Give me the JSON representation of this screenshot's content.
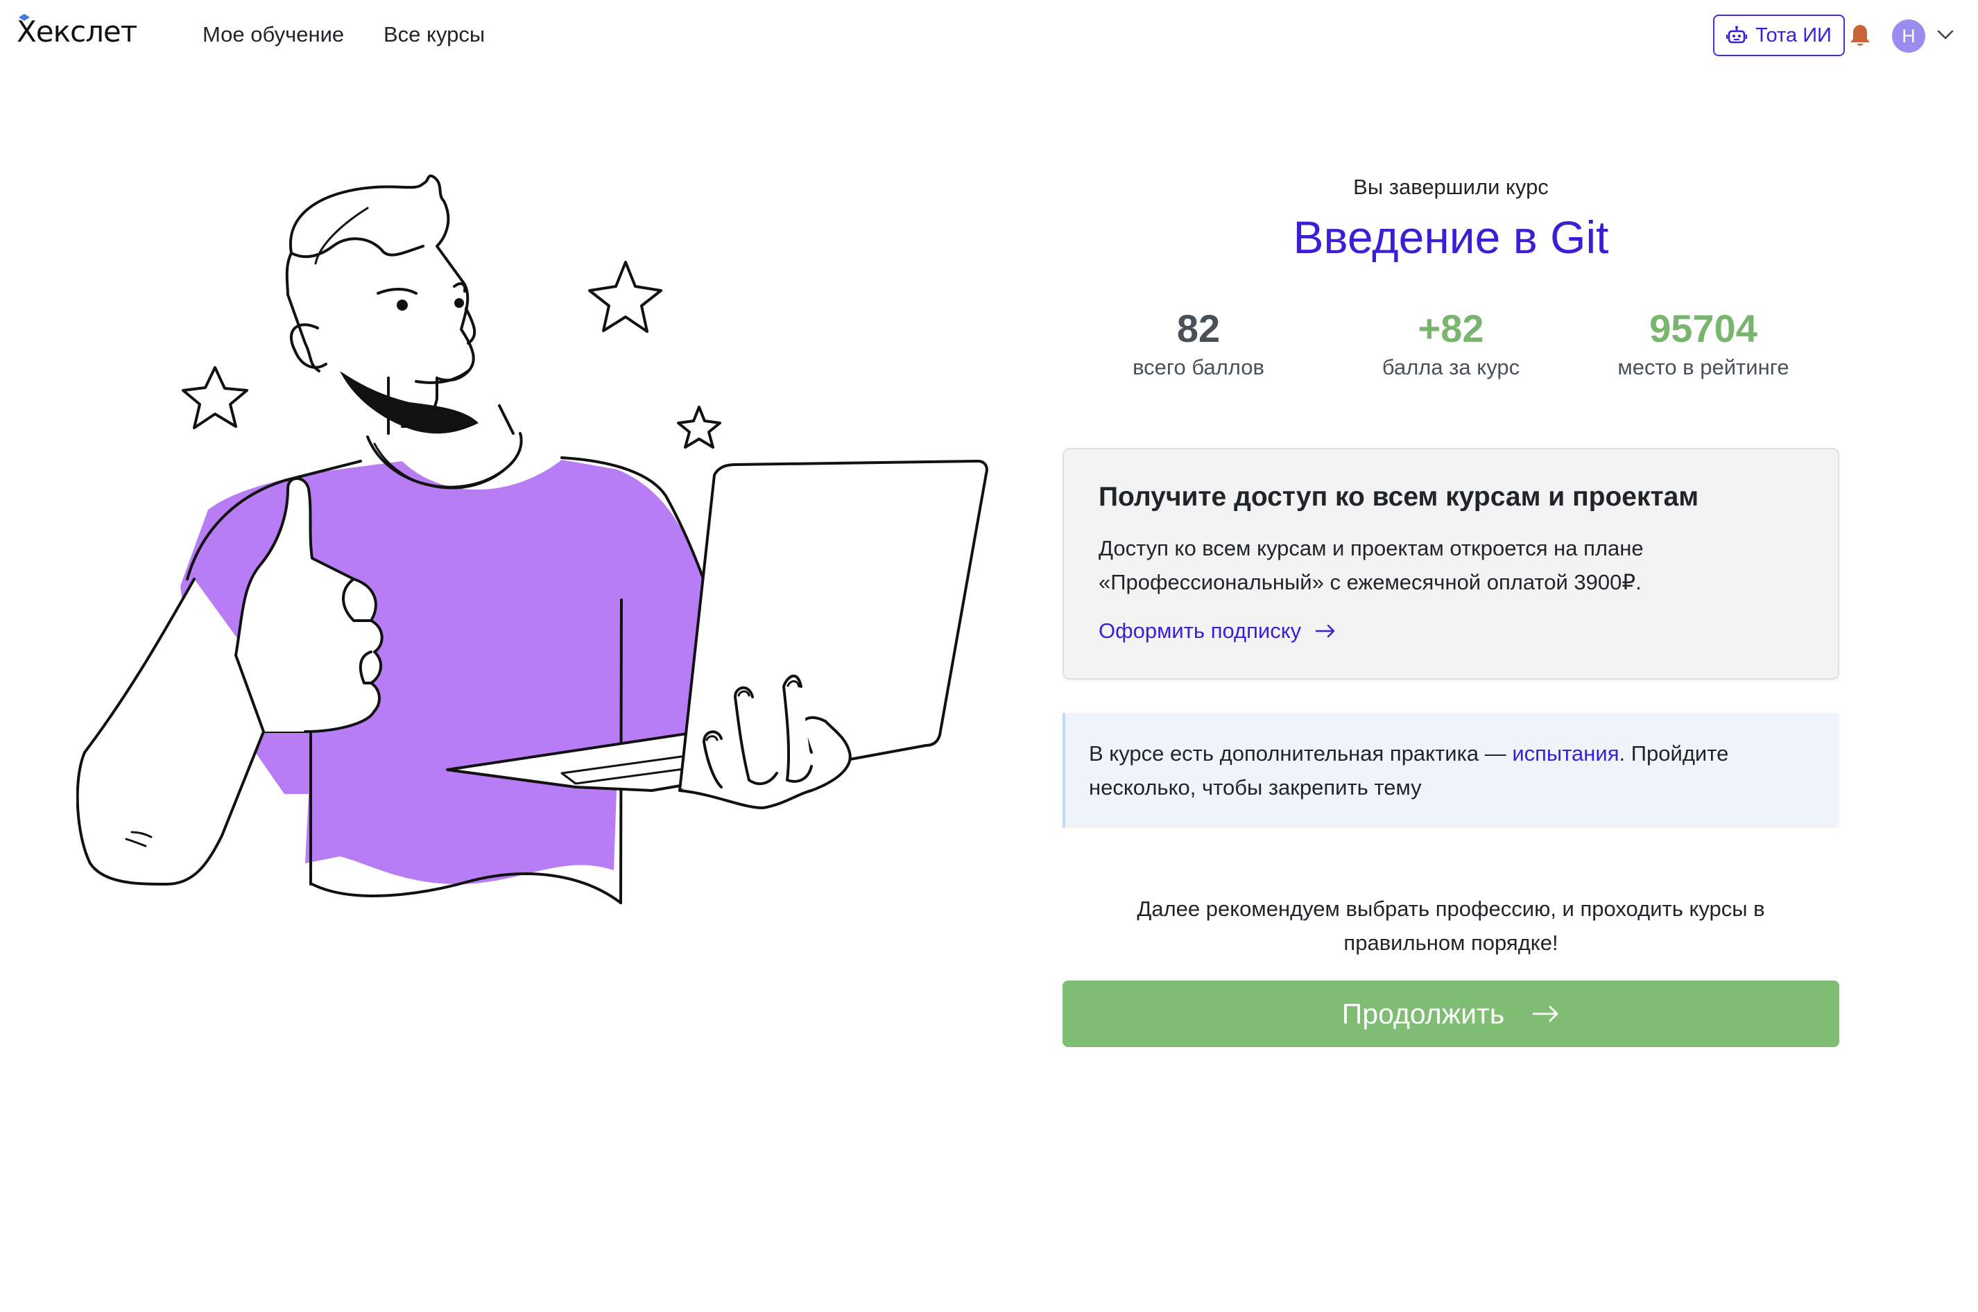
{
  "header": {
    "logo_text": "Хекслет",
    "nav": {
      "my_learning": "Мое обучение",
      "all_courses": "Все курсы"
    },
    "ai_button_label": "Тота ИИ",
    "avatar_initial": "Н",
    "icons": {
      "ai": "robot-icon",
      "notifications": "bell-icon",
      "menu": "chevron-down-icon"
    },
    "colors": {
      "accent": "#3a1fd6",
      "bell": "#c8643c",
      "avatar": "#9b8cf0"
    }
  },
  "illustration": {
    "subject": "man-with-laptop-thumbs-up",
    "colors": {
      "shirt": "#b87cf5",
      "outline": "#111111"
    }
  },
  "completion": {
    "label": "Вы завершили курс",
    "course_title": "Введение в Git"
  },
  "stats": {
    "total_points": {
      "value": "82",
      "label": "всего баллов"
    },
    "course_points": {
      "value": "+82",
      "label": "балла за курс"
    },
    "rating_place": {
      "value": "95704",
      "label": "место в рейтинге"
    },
    "colors": {
      "neutral": "#495057",
      "positive": "#7ab56f"
    }
  },
  "subscribe": {
    "title": "Получите доступ ко всем курсам и проектам",
    "text": "Доступ ко всем курсам и проектам откроется на плане «Профессиональный» с ежемесячной оплатой 3900₽.",
    "link_label": "Оформить подписку",
    "link_icon": "arrow-right-icon"
  },
  "practice_alert": {
    "text_before": "В курсе есть дополнительная практика — ",
    "link_label": "испытания",
    "text_after": ". Пройдите несколько, чтобы закрепить тему"
  },
  "recommendation": {
    "text": "Далее рекомендуем выбрать профессию, и проходить курсы в правильном порядке!"
  },
  "continue_button": {
    "label": "Продолжить",
    "icon": "arrow-right-icon",
    "color": "#7ebd73"
  }
}
